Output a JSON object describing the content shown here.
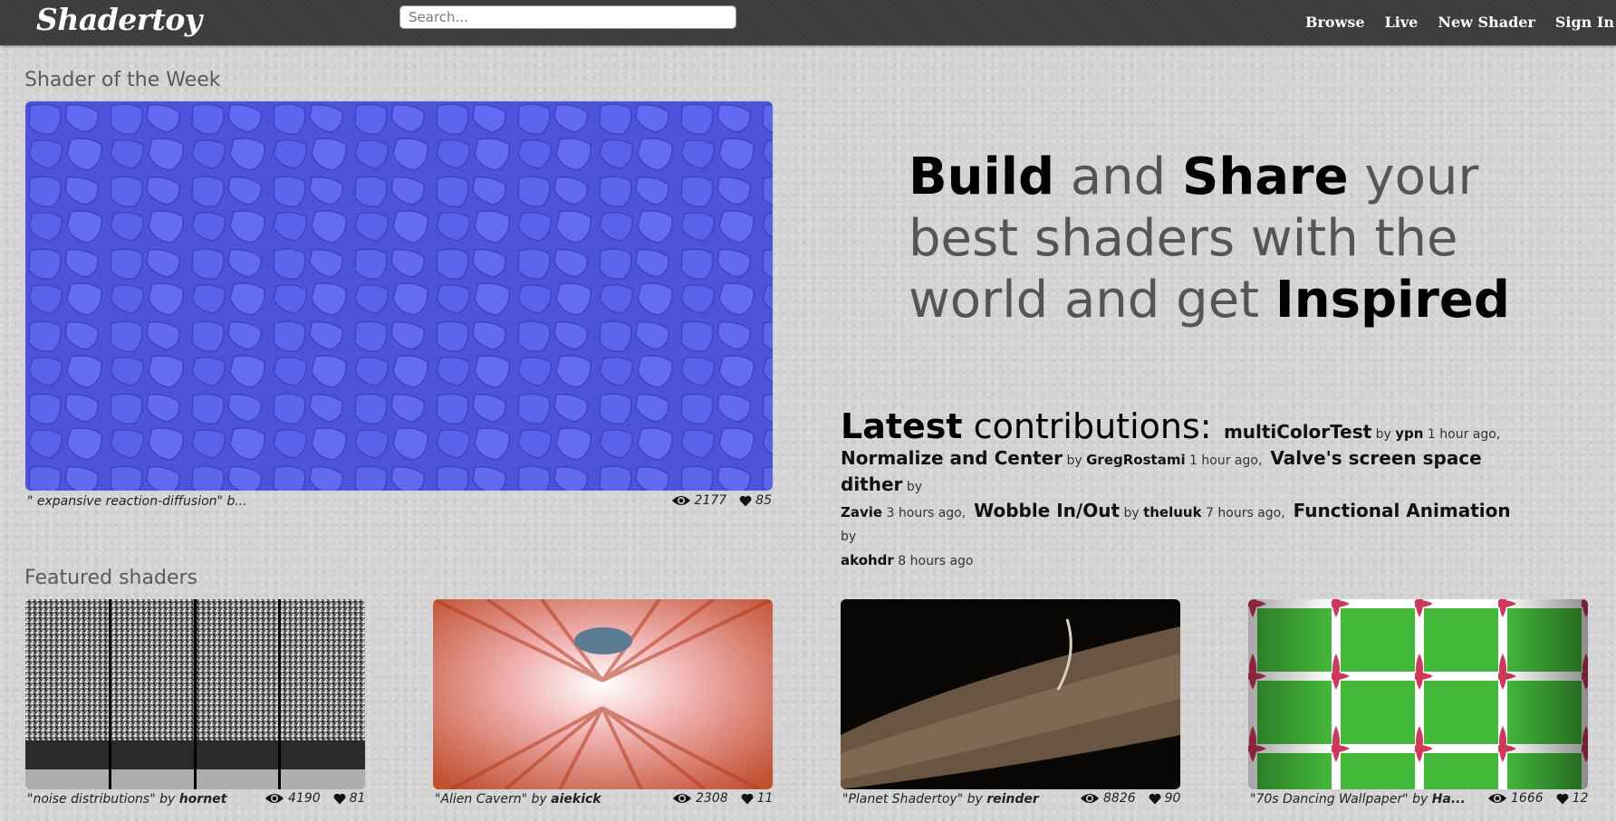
{
  "header": {
    "logo": "Shadertoy",
    "search_placeholder": "Search...",
    "nav": [
      "Browse",
      "Live",
      "New Shader",
      "Sign In"
    ]
  },
  "week": {
    "section_title": "Shader of the Week",
    "caption": "\" expansive reaction-diffusion\" b...",
    "views": "2177",
    "likes": "85"
  },
  "hero": {
    "w1": "Build",
    "w2": "and",
    "w3": "Share",
    "w4": "your",
    "line2": "best shaders with the",
    "line3a": "world and get",
    "line3b": "Inspired"
  },
  "latest": {
    "heading_bold": "Latest",
    "heading_rest": "contributions:",
    "items": [
      {
        "name": "multiColorTest",
        "by": "by",
        "author": "ypn",
        "time": "1 hour ago,"
      },
      {
        "name": "Normalize and Center",
        "by": "by",
        "author": "GregRostami",
        "time": "1 hour ago,"
      },
      {
        "name": "Valve's screen space dither",
        "by": "by",
        "author": "Zavie",
        "time": "3 hours ago,"
      },
      {
        "name": "Wobble In/Out",
        "by": "by",
        "author": "theluuk",
        "time": "7 hours ago,"
      },
      {
        "name": "Functional Animation",
        "by": "by",
        "author": "akohdr",
        "time": "8 hours ago"
      }
    ]
  },
  "featured": {
    "section_title": "Featured shaders",
    "items": [
      {
        "title": "\"noise distributions\"",
        "by": "by",
        "author": "hornet",
        "views": "4190",
        "likes": "81"
      },
      {
        "title": "\"Alien Cavern\"",
        "by": "by",
        "author": "aiekick",
        "views": "2308",
        "likes": "11"
      },
      {
        "title": "\"Planet Shadertoy\"",
        "by": "by",
        "author": "reinder",
        "views": "8826",
        "likes": "90"
      },
      {
        "title": "\"70s Dancing Wallpaper\"",
        "by": "by",
        "author": "Ha...",
        "views": "1666",
        "likes": "12"
      }
    ]
  },
  "colors": {
    "header_bg": "#3b3b3b",
    "page_bg": "#d3d3d3",
    "week_shader": "#5a62e8"
  },
  "icons": [
    "eye-icon",
    "heart-icon"
  ]
}
